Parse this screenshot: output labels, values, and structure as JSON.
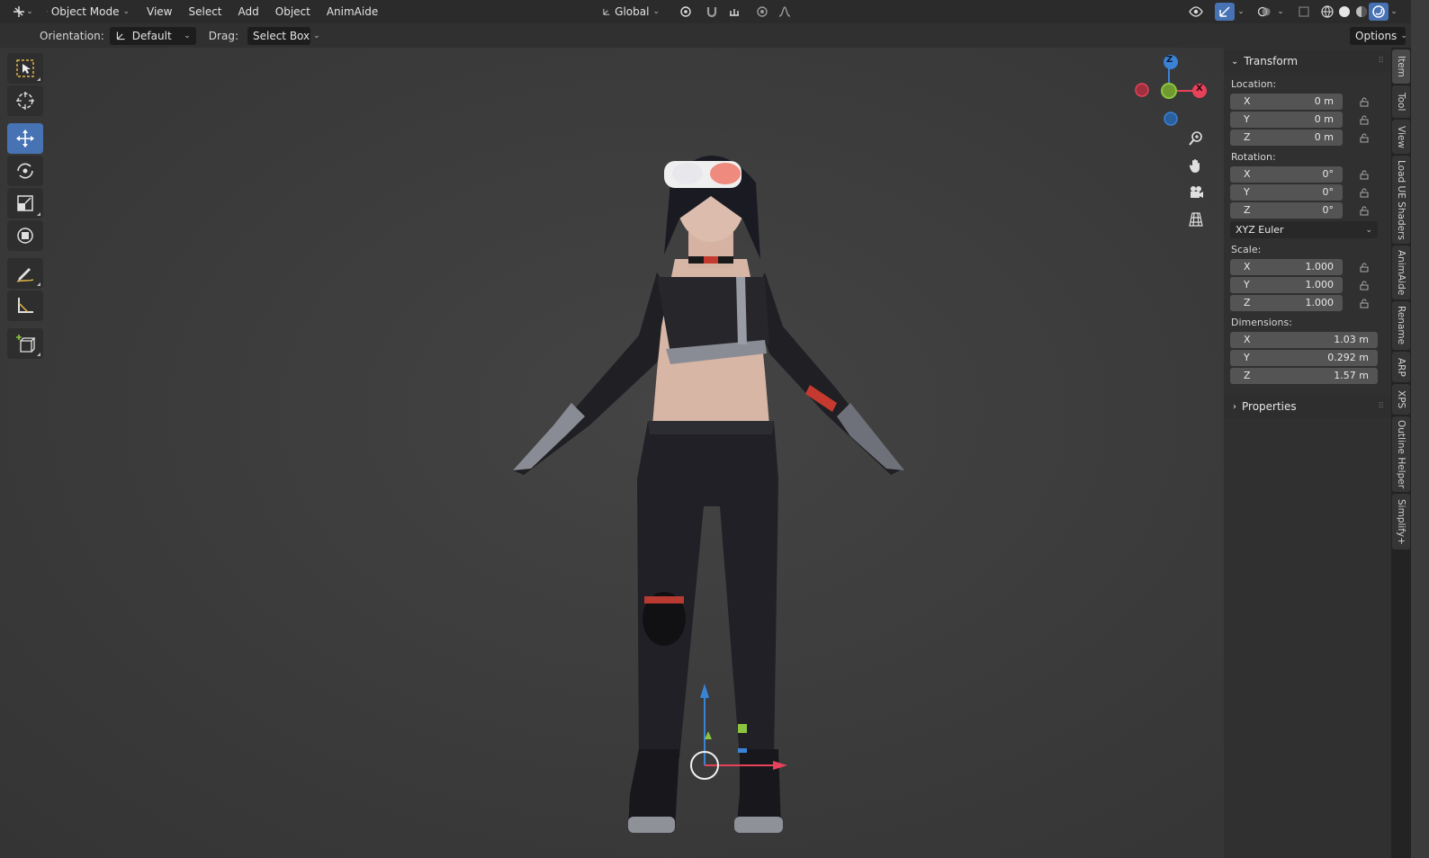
{
  "header": {
    "mode": "Object Mode",
    "menus": [
      "View",
      "Select",
      "Add",
      "Object",
      "AnimAide"
    ],
    "transform_orientation": "Global"
  },
  "tool_header": {
    "orientation_label": "Orientation:",
    "orientation_value": "Default",
    "drag_label": "Drag:",
    "drag_value": "Select Box",
    "options_label": "Options"
  },
  "gizmo": {
    "z": "Z",
    "x": "X"
  },
  "transform": {
    "title": "Transform",
    "location_label": "Location:",
    "location": [
      {
        "axis": "X",
        "value": "0 m"
      },
      {
        "axis": "Y",
        "value": "0 m"
      },
      {
        "axis": "Z",
        "value": "0 m"
      }
    ],
    "rotation_label": "Rotation:",
    "rotation": [
      {
        "axis": "X",
        "value": "0°"
      },
      {
        "axis": "Y",
        "value": "0°"
      },
      {
        "axis": "Z",
        "value": "0°"
      }
    ],
    "rotation_mode": "XYZ Euler",
    "scale_label": "Scale:",
    "scale": [
      {
        "axis": "X",
        "value": "1.000"
      },
      {
        "axis": "Y",
        "value": "1.000"
      },
      {
        "axis": "Z",
        "value": "1.000"
      }
    ],
    "dimensions_label": "Dimensions:",
    "dimensions": [
      {
        "axis": "X",
        "value": "1.03 m"
      },
      {
        "axis": "Y",
        "value": "0.292 m"
      },
      {
        "axis": "Z",
        "value": "1.57 m"
      }
    ]
  },
  "properties_title": "Properties",
  "side_tabs": [
    "Item",
    "Tool",
    "View",
    "Load UE Shaders",
    "AnimAide",
    "Rename",
    "ARP",
    "XPS",
    "Outline Helper",
    "Simplify+"
  ],
  "colors": {
    "accent": "#4772b3",
    "axis_x": "#e8415a",
    "axis_y": "#8bc53f",
    "axis_z": "#3a82d6"
  }
}
